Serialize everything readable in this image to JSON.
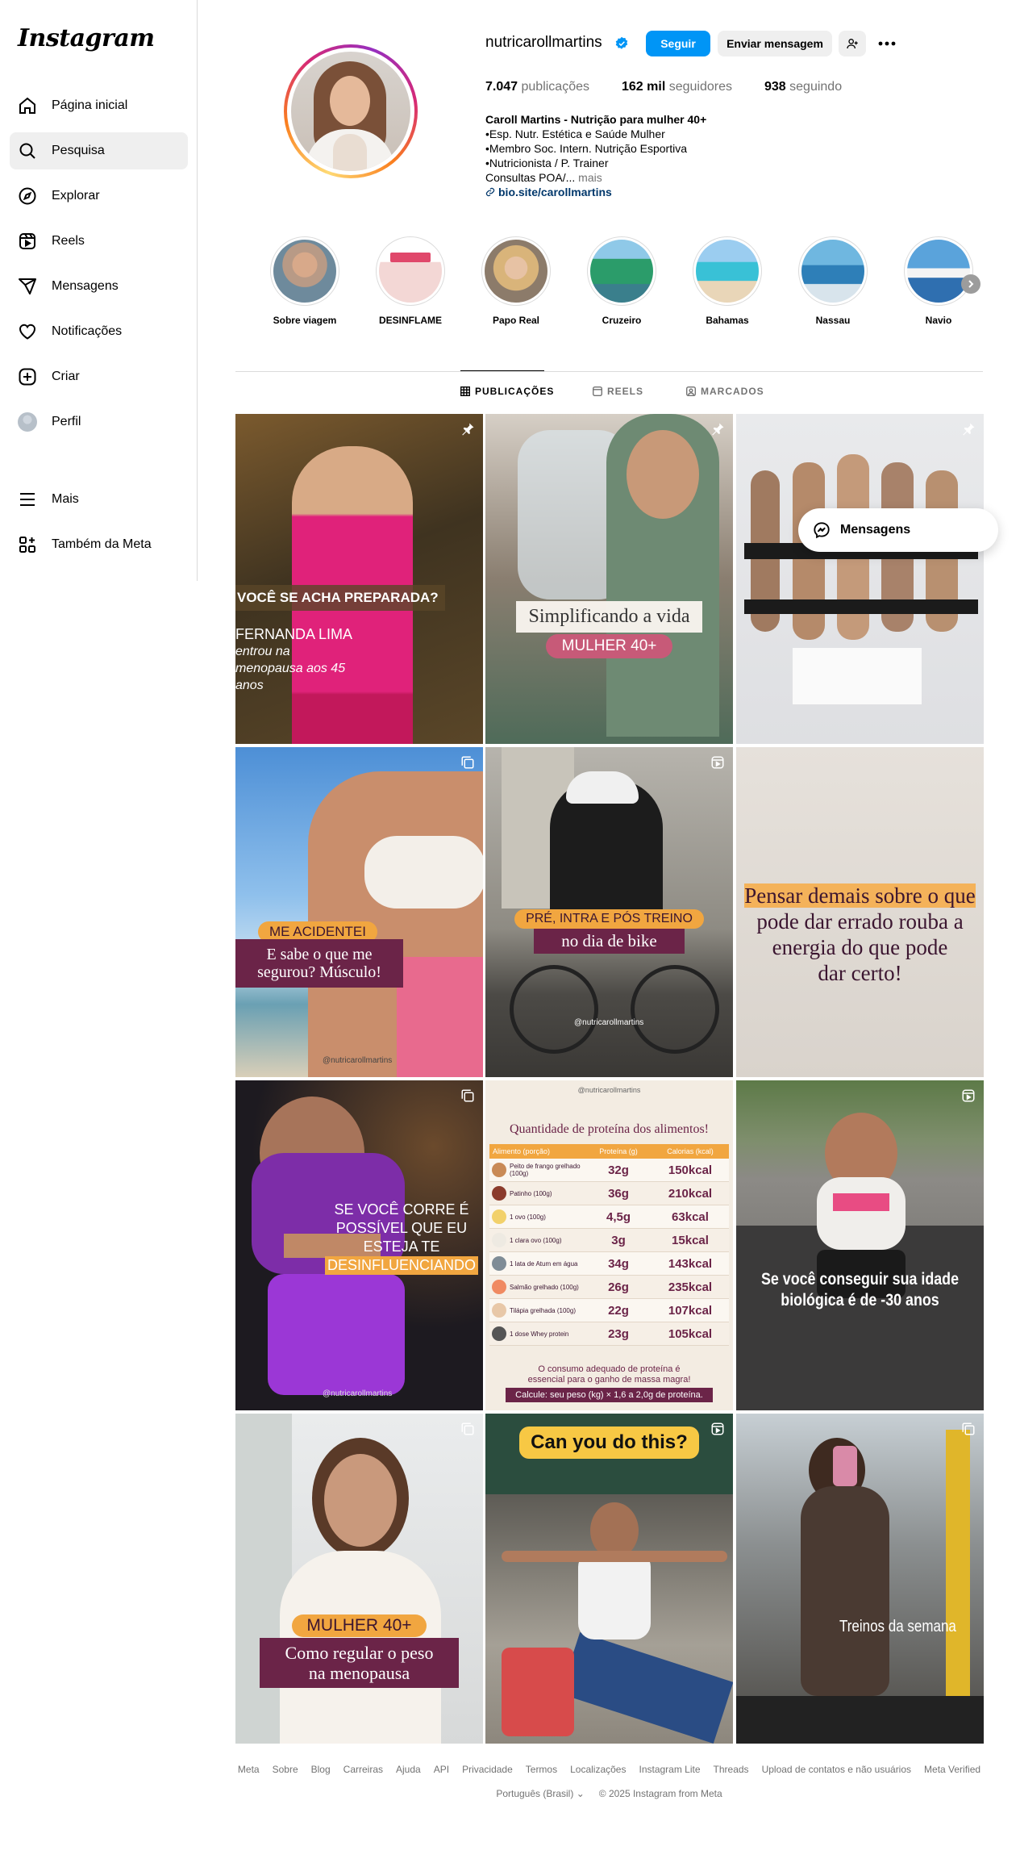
{
  "app": {
    "logo": "Instagram"
  },
  "sidebar": {
    "items": [
      {
        "label": "Página inicial",
        "icon": "home-icon"
      },
      {
        "label": "Pesquisa",
        "icon": "search-icon",
        "active": true
      },
      {
        "label": "Explorar",
        "icon": "compass-icon"
      },
      {
        "label": "Reels",
        "icon": "reels-icon"
      },
      {
        "label": "Mensagens",
        "icon": "send-icon"
      },
      {
        "label": "Notificações",
        "icon": "heart-icon"
      },
      {
        "label": "Criar",
        "icon": "plus-square-icon"
      },
      {
        "label": "Perfil",
        "icon": "avatar"
      },
      {
        "label": "Mais",
        "icon": "menu-icon"
      },
      {
        "label": "Também da Meta",
        "icon": "meta-apps-icon"
      }
    ]
  },
  "profile": {
    "username": "nutricarollmartins",
    "follow_label": "Seguir",
    "message_label": "Enviar mensagem",
    "stats": {
      "posts_value": "7.047",
      "posts_label": "publicações",
      "followers_value": "162 mil",
      "followers_label": "seguidores",
      "following_value": "938",
      "following_label": "seguindo"
    },
    "bio": {
      "name": "Caroll Martins - Nutrição para mulher 40+",
      "line1": "•Esp. Nutr. Estética e Saúde Mulher",
      "line2": "•Membro Soc. Intern. Nutrição Esportiva",
      "line3": "•Nutricionista / P. Trainer",
      "line4": "Consultas POA/...",
      "more": "mais",
      "link": "bio.site/carollmartins"
    }
  },
  "highlights": [
    {
      "label": "Sobre viagem"
    },
    {
      "label": "DESINFLAME"
    },
    {
      "label": "Papo Real"
    },
    {
      "label": "Cruzeiro"
    },
    {
      "label": "Bahamas"
    },
    {
      "label": "Nassau"
    },
    {
      "label": "Navio"
    }
  ],
  "tabs": [
    {
      "label": "PUBLICAÇÕES",
      "active": true
    },
    {
      "label": "REELS"
    },
    {
      "label": "MARCADOS"
    }
  ],
  "posts": {
    "p1": {
      "title": "VOCÊ SE ACHA PREPARADA?",
      "name": "FERNANDA LIMA",
      "line1": "entrou na",
      "line2": "menopausa aos 45",
      "line3": "anos"
    },
    "p2": {
      "title": "Simplificando a vida",
      "badge": "MULHER 40+"
    },
    "p4": {
      "badge": "ME ACIDENTEI",
      "line1": "E sabe o que me",
      "line2": "segurou? Músculo!",
      "handle": "@nutricarollmartins"
    },
    "p5": {
      "badge": "PRÉ, INTRA E PÓS TREINO",
      "line1": "no dia de bike",
      "handle": "@nutricarollmartins"
    },
    "p6": {
      "line1": "Pensar demais sobre o que",
      "line2": "pode dar errado rouba a",
      "line3": "energia do que pode",
      "line4": "dar certo!"
    },
    "p7": {
      "line1": "SE VOCÊ CORRE É",
      "line2": "POSSÍVEL QUE EU",
      "line3": "ESTEJA TE",
      "line4": "DESINFLUENCIANDO",
      "handle": "@nutricarollmartins"
    },
    "p8": {
      "handle": "@nutricarollmartins",
      "title": "Quantidade de proteína dos alimentos!",
      "headers": [
        "Alimento (porção)",
        "Proteína (g)",
        "Calorias (kcal)"
      ],
      "rows": [
        [
          "Peito de frango grelhado (100g)",
          "32g",
          "150kcal"
        ],
        [
          "Patinho (100g)",
          "36g",
          "210kcal"
        ],
        [
          "1 ovo (100g)",
          "4,5g",
          "63kcal"
        ],
        [
          "1 clara ovo (100g)",
          "3g",
          "15kcal"
        ],
        [
          "1 lata de Atum em água",
          "34g",
          "143kcal"
        ],
        [
          "Salmão grelhado (100g)",
          "26g",
          "235kcal"
        ],
        [
          "Tilápia grelhada (100g)",
          "22g",
          "107kcal"
        ],
        [
          "1 dose Whey protein",
          "23g",
          "105kcal"
        ]
      ],
      "note1": "O consumo adequado de proteína é",
      "note2": "essencial para o ganho de massa magra!",
      "calc": "Calcule: seu peso (kg) × 1,6 a 2,0g de proteína."
    },
    "p9": {
      "line1": "Se você conseguir sua idade",
      "line2": "biológica é de -30 anos"
    },
    "p10": {
      "badge": "MULHER 40+",
      "line1": "Como regular o peso",
      "line2": "na menopausa"
    },
    "p11": {
      "title": "Can you do this?"
    },
    "p12": {
      "line1": "Treinos da semana"
    }
  },
  "floating_message": {
    "label": "Mensagens"
  },
  "footer": {
    "links": [
      "Meta",
      "Sobre",
      "Blog",
      "Carreiras",
      "Ajuda",
      "API",
      "Privacidade",
      "Termos",
      "Localizações",
      "Instagram Lite",
      "Threads",
      "Upload de contatos e não usuários",
      "Meta Verified"
    ],
    "language": "Português (Brasil)",
    "copyright": "© 2025 Instagram from Meta"
  },
  "colors": {
    "accent": "#0095f6",
    "plum": "#6b2448",
    "orange": "#f4a340"
  }
}
